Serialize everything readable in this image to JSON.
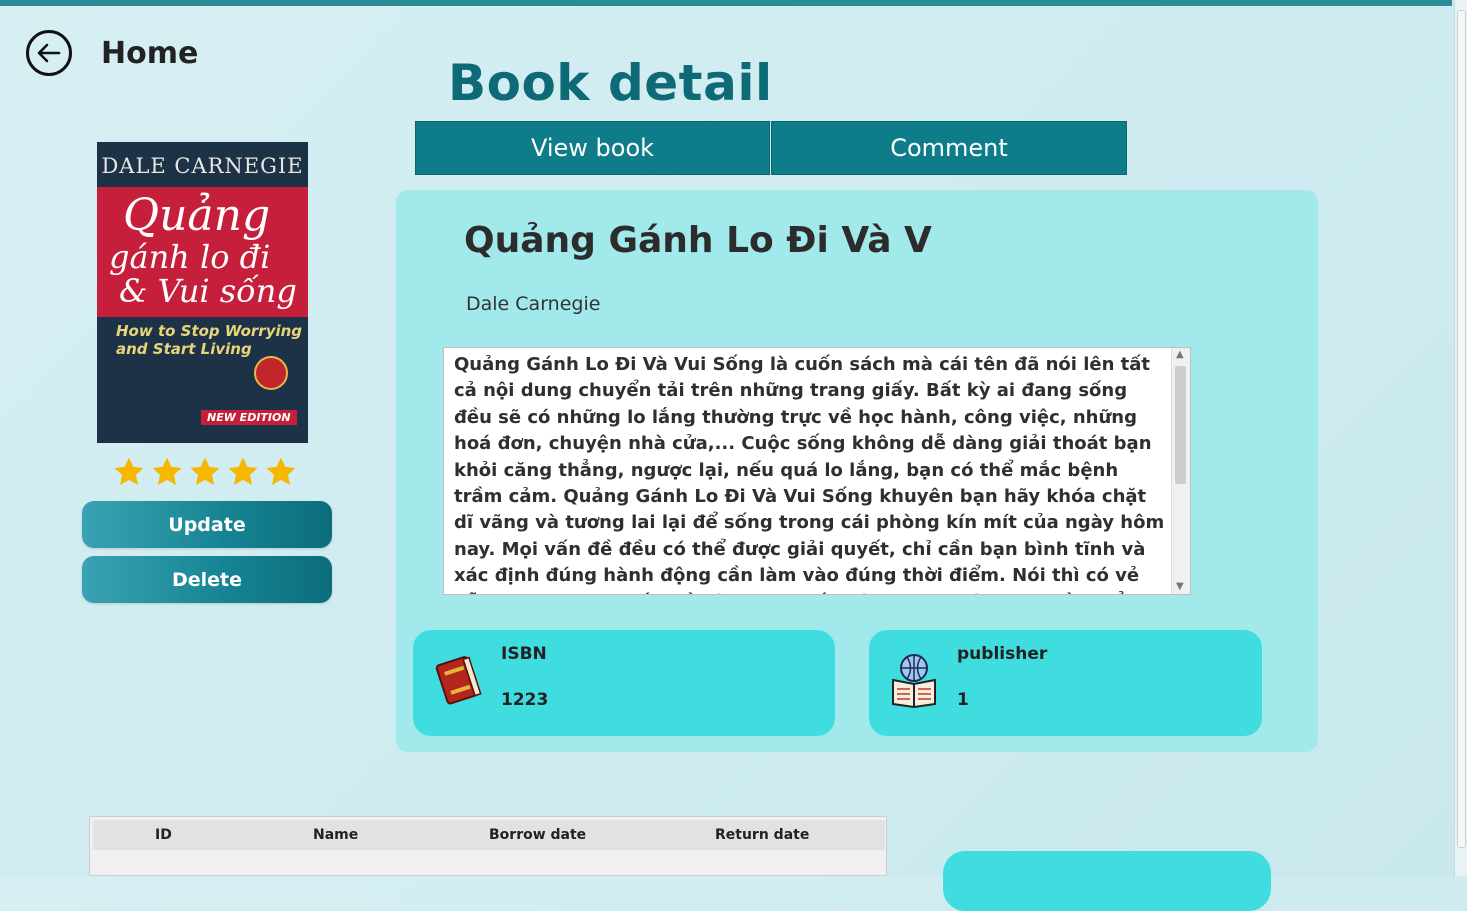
{
  "nav": {
    "back_icon": "arrow-left-circle-icon",
    "home_label": "Home"
  },
  "page": {
    "title": "Book detail"
  },
  "tabs": [
    {
      "label": "View book"
    },
    {
      "label": "Comment"
    }
  ],
  "cover": {
    "author": "DALE CARNEGIE",
    "title_line1": "Quảng",
    "title_line2": "gánh lo đi",
    "title_line3": "& Vui sống",
    "subtitle_line1": "How to Stop Worrying",
    "subtitle_line2": "and Start Living",
    "edition": "NEW EDITION"
  },
  "rating": {
    "stars": 5,
    "max": 5,
    "color": "#f5b800"
  },
  "actions": {
    "update_label": "Update",
    "delete_label": "Delete"
  },
  "book": {
    "title": "Quảng Gánh Lo Đi Và V",
    "author": "Dale Carnegie",
    "description": "Quảng Gánh Lo Đi Và Vui Sống là cuốn sách mà cái tên đã nói lên tất cả nội dung chuyển tải trên những trang giấy. Bất kỳ ai đang sống đều sẽ có những lo lắng thường trực về học hành, công việc, những hoá đơn, chuyện nhà cửa,... Cuộc sống không dễ dàng giải thoát bạn khỏi căng thẳng, ngược lại, nếu quá lo lắng, bạn có thể mắc bệnh trầm cảm. Quảng Gánh Lo Đi Và Vui Sống khuyên bạn hãy khóa chặt dĩ vãng và tương lai lại để sống trong cái phòng kín mít của ngày hôm nay. Mọi vấn đề đều có thể được giải quyết, chỉ cần bạn bình tĩnh và xác định đúng hành động cần làm vào đúng thời điểm. Nói thì có vẻ dễ nhưng những vấn đề liên quan đến các trạng thái tinh thần chẳng bao giờ dễ giải"
  },
  "info": {
    "isbn_label": "ISBN",
    "isbn_value": "1223",
    "isbn_icon": "book-icon",
    "publisher_label": "publisher",
    "publisher_value": "1",
    "publisher_icon": "globe-book-icon"
  },
  "borrow_table": {
    "columns": [
      "ID",
      "Name",
      "Borrow date",
      "Return date"
    ]
  },
  "colors": {
    "accent": "#0f7d89",
    "title": "#0e6a76",
    "panel": "#a2e9ec",
    "card": "#40dde0"
  }
}
